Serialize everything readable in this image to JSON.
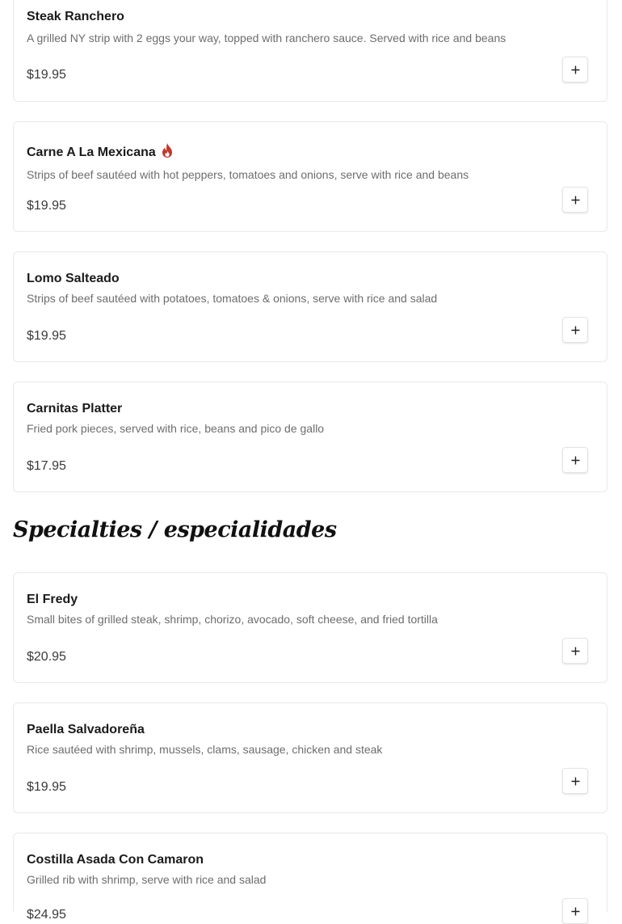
{
  "menu": {
    "items": [
      {
        "name": "Steak Ranchero",
        "description": "A grilled NY strip with 2 eggs your way, topped with ranchero sauce. Served with rice and beans",
        "price": "$19.95",
        "spicy": false
      },
      {
        "name": "Carne A La Mexicana",
        "description": "Strips of beef sautéed with hot peppers, tomatoes and onions, serve with rice and beans",
        "price": "$19.95",
        "spicy": true
      },
      {
        "name": "Lomo Salteado",
        "description": "Strips of beef sautéed with potatoes, tomatoes & onions, serve with rice and salad",
        "price": "$19.95",
        "spicy": false
      },
      {
        "name": "Carnitas Platter",
        "description": "Fried pork pieces, served with rice, beans and pico de gallo",
        "price": "$17.95",
        "spicy": false
      }
    ]
  },
  "specialties": {
    "heading": "Specialties / especialidades",
    "items": [
      {
        "name": "El Fredy",
        "description": "Small bites of grilled steak, shrimp, chorizo, avocado, soft cheese, and fried tortilla",
        "price": "$20.95",
        "spicy": false
      },
      {
        "name": "Paella Salvadoreña",
        "description": "Rice sautéed with shrimp, mussels, clams, sausage, chicken and steak",
        "price": "$19.95",
        "spicy": false
      },
      {
        "name": "Costilla Asada Con Camaron",
        "description": "Grilled rib with shrimp, serve with rice and salad",
        "price": "$24.95",
        "spicy": false
      }
    ]
  },
  "icons": {
    "add": "plus-icon",
    "spicy": "flame-icon"
  },
  "colors": {
    "spicy": "#c0392b",
    "border": "#e9e9e9",
    "description": "#6d6d6d"
  }
}
